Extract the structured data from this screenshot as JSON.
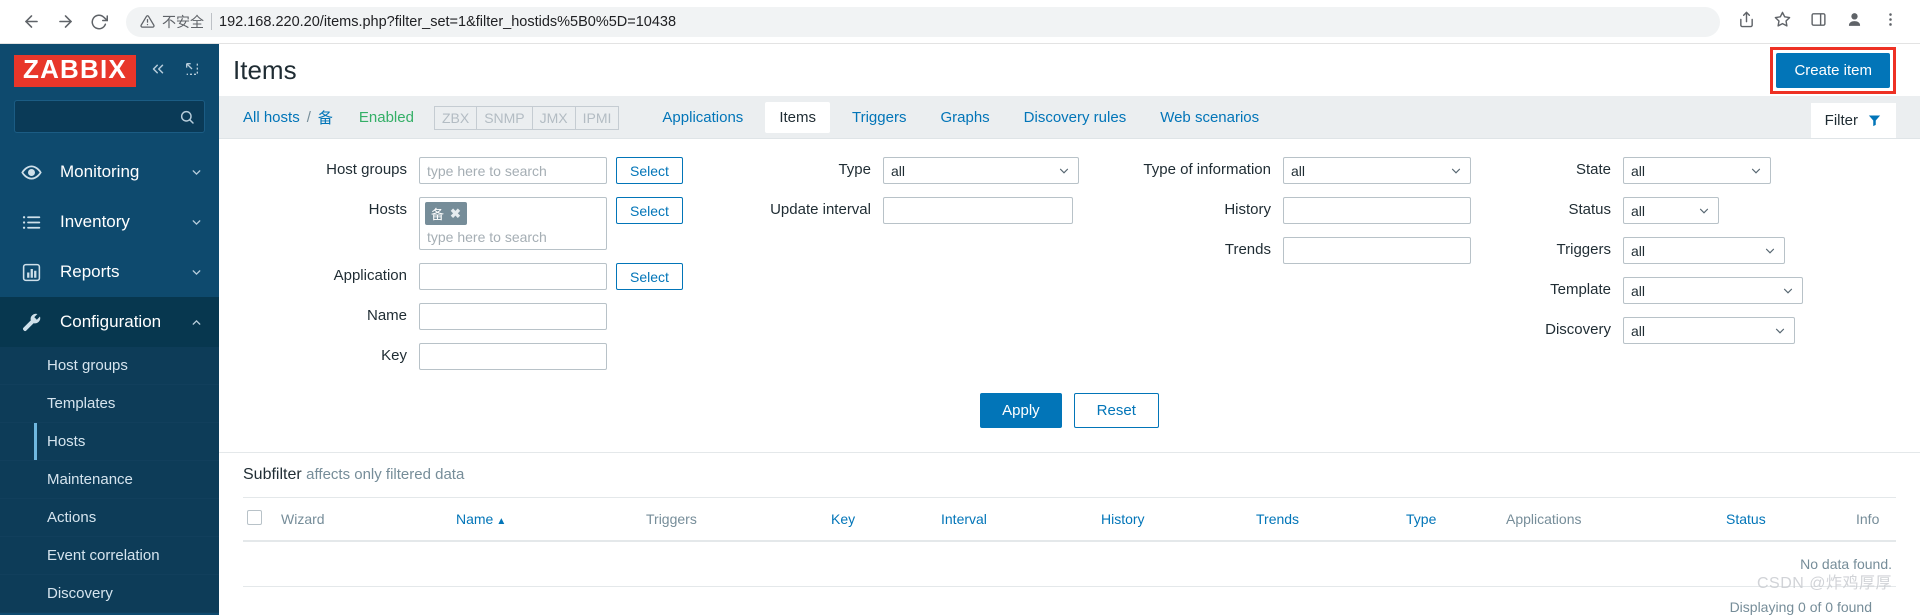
{
  "browser": {
    "back_icon": "back-arrow-icon",
    "forward_icon": "forward-arrow-icon",
    "reload_icon": "reload-icon",
    "insecure_label": "不安全",
    "url": "192.168.220.20/items.php?filter_set=1&filter_hostids%5B0%5D=10438",
    "share_icon": "share-icon",
    "bookmark_icon": "star-icon",
    "sidepanel_icon": "side-panel-icon",
    "profile_icon": "profile-icon",
    "menu_icon": "kebab-menu-icon"
  },
  "sidebar": {
    "logo": "ZABBIX",
    "collapse_icon": "double-chevron-left-icon",
    "compact_icon": "collapse-arrow-icon",
    "search_placeholder": "",
    "search_icon": "search-icon",
    "items": [
      {
        "label": "Monitoring",
        "icon": "eye-icon",
        "arrow": "chevron-down-icon",
        "active": false
      },
      {
        "label": "Inventory",
        "icon": "list-icon",
        "arrow": "chevron-down-icon",
        "active": false
      },
      {
        "label": "Reports",
        "icon": "bar-chart-icon",
        "arrow": "chevron-down-icon",
        "active": false
      },
      {
        "label": "Configuration",
        "icon": "wrench-icon",
        "arrow": "chevron-up-icon",
        "active": true
      }
    ],
    "submenu": [
      {
        "label": "Host groups",
        "selected": false
      },
      {
        "label": "Templates",
        "selected": false
      },
      {
        "label": "Hosts",
        "selected": true
      },
      {
        "label": "Maintenance",
        "selected": false
      },
      {
        "label": "Actions",
        "selected": false
      },
      {
        "label": "Event correlation",
        "selected": false
      },
      {
        "label": "Discovery",
        "selected": false
      }
    ]
  },
  "header": {
    "title": "Items",
    "create_button": "Create item"
  },
  "breadcrumb": {
    "all_hosts": "All hosts",
    "separator": "/",
    "host": "备",
    "status": "Enabled",
    "protocols": [
      "ZBX",
      "SNMP",
      "JMX",
      "IPMI"
    ],
    "tabs": [
      {
        "label": "Applications",
        "selected": false
      },
      {
        "label": "Items",
        "selected": true
      },
      {
        "label": "Triggers",
        "selected": false
      },
      {
        "label": "Graphs",
        "selected": false
      },
      {
        "label": "Discovery rules",
        "selected": false
      },
      {
        "label": "Web scenarios",
        "selected": false
      }
    ],
    "filter_tab": "Filter",
    "filter_icon": "funnel-icon"
  },
  "filter": {
    "col1": [
      {
        "label": "Host groups",
        "type": "text",
        "value": "",
        "placeholder": "type here to search",
        "button": "Select"
      },
      {
        "label": "Hosts",
        "type": "multiselect",
        "chips": [
          "备"
        ],
        "placeholder": "type here to search",
        "button": "Select"
      },
      {
        "label": "Application",
        "type": "text",
        "value": "",
        "placeholder": "",
        "button": "Select"
      },
      {
        "label": "Name",
        "type": "text",
        "value": "",
        "placeholder": ""
      },
      {
        "label": "Key",
        "type": "text",
        "value": "",
        "placeholder": ""
      }
    ],
    "col2": [
      {
        "label": "Type",
        "type": "select",
        "value": "all"
      },
      {
        "label": "Update interval",
        "type": "text",
        "value": "",
        "placeholder": ""
      }
    ],
    "col3": [
      {
        "label": "Type of information",
        "type": "select",
        "value": "all"
      },
      {
        "label": "History",
        "type": "text",
        "value": "",
        "placeholder": ""
      },
      {
        "label": "Trends",
        "type": "text",
        "value": "",
        "placeholder": ""
      }
    ],
    "col4": [
      {
        "label": "State",
        "type": "select",
        "value": "all"
      },
      {
        "label": "Status",
        "type": "select",
        "value": "all"
      },
      {
        "label": "Triggers",
        "type": "select",
        "value": "all"
      },
      {
        "label": "Template",
        "type": "select",
        "value": "all"
      },
      {
        "label": "Discovery",
        "type": "select",
        "value": "all"
      }
    ],
    "apply_button": "Apply",
    "reset_button": "Reset"
  },
  "subfilter": {
    "title": "Subfilter",
    "hint": "affects only filtered data"
  },
  "table": {
    "columns": [
      {
        "label": "Wizard",
        "link": false,
        "sorted": false
      },
      {
        "label": "Name",
        "link": true,
        "sorted": true,
        "sort_arrow": "▲"
      },
      {
        "label": "Triggers",
        "link": false,
        "sorted": false
      },
      {
        "label": "Key",
        "link": true,
        "sorted": false
      },
      {
        "label": "Interval",
        "link": true,
        "sorted": false
      },
      {
        "label": "History",
        "link": true,
        "sorted": false
      },
      {
        "label": "Trends",
        "link": true,
        "sorted": false
      },
      {
        "label": "Type",
        "link": true,
        "sorted": false
      },
      {
        "label": "Applications",
        "link": false,
        "sorted": false
      },
      {
        "label": "Status",
        "link": true,
        "sorted": false
      },
      {
        "label": "Info",
        "link": false,
        "sorted": false
      }
    ],
    "empty_message": "No data found.",
    "footer": "Displaying 0 of 0 found"
  },
  "watermark": "CSDN @炸鸡厚厚",
  "colors": {
    "accent_blue": "#0275b8",
    "sidebar_bg": "#0e4a6e",
    "logo_red": "#e8362a",
    "highlight_red": "#ee3124",
    "status_green": "#34af67"
  }
}
